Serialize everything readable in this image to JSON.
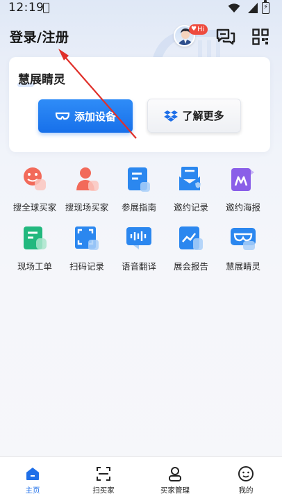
{
  "status_bar": {
    "time": "12:19"
  },
  "header": {
    "login_label": "登录/注册",
    "hi_badge": "Hi"
  },
  "device_card": {
    "title": "慧展睛灵",
    "add_button": "添加设备",
    "more_button": "了解更多"
  },
  "grid": {
    "items": [
      {
        "label": "搜全球买家",
        "icon": "globe-buyer-icon"
      },
      {
        "label": "搜现场买家",
        "icon": "onsite-buyer-icon"
      },
      {
        "label": "参展指南",
        "icon": "guide-icon"
      },
      {
        "label": "邀约记录",
        "icon": "invite-record-icon"
      },
      {
        "label": "邀约海报",
        "icon": "invite-poster-icon"
      },
      {
        "label": "现场工单",
        "icon": "work-order-icon"
      },
      {
        "label": "扫码记录",
        "icon": "scan-record-icon"
      },
      {
        "label": "语音翻译",
        "icon": "voice-translate-icon"
      },
      {
        "label": "展会报告",
        "icon": "report-icon"
      },
      {
        "label": "慧展睛灵",
        "icon": "smart-glasses-icon"
      }
    ]
  },
  "bottom_nav": {
    "items": [
      {
        "label": "主页",
        "icon": "home-icon",
        "active": true
      },
      {
        "label": "扫买家",
        "icon": "scan-icon",
        "active": false
      },
      {
        "label": "买家管理",
        "icon": "person-icon",
        "active": false
      },
      {
        "label": "我的",
        "icon": "smile-icon",
        "active": false
      }
    ]
  },
  "colors": {
    "accent": "#1f6fe8",
    "badge": "#ee4b3e",
    "annotation_arrow": "#e0302a"
  }
}
